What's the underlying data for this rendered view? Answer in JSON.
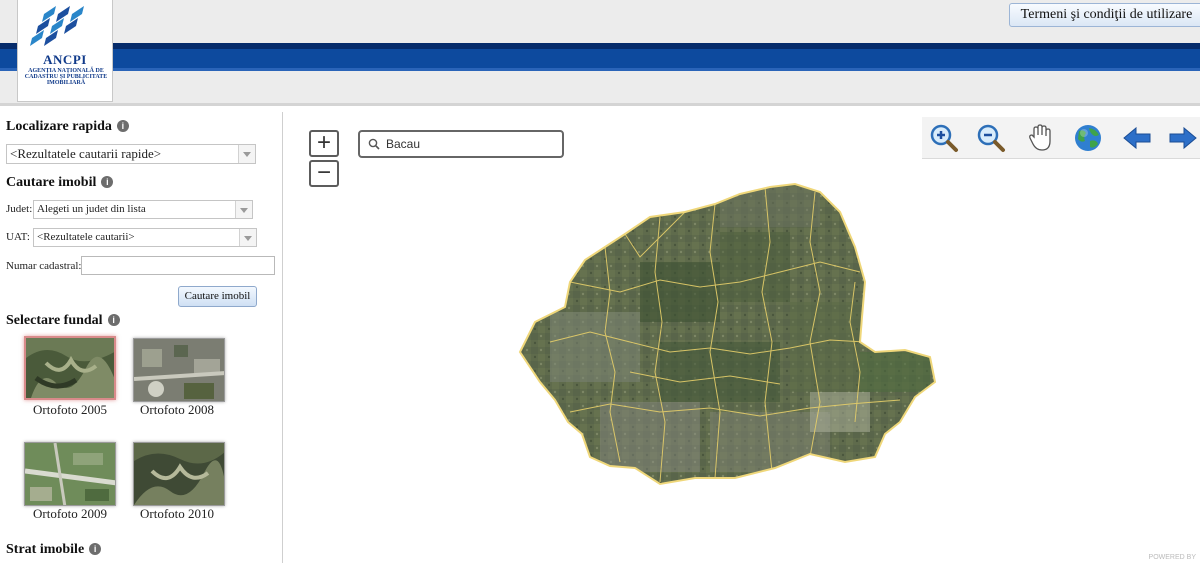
{
  "header": {
    "logo_text": "ANCPI",
    "logo_subtitle": "AGENȚIA NAȚIONALĂ DE CADASTRU ȘI PUBLICITATE IMOBILIARĂ",
    "terms_button": "Termeni şi condiţii de utilizare",
    "colors": {
      "brand_blue": "#0d4a9e"
    }
  },
  "sidebar": {
    "quick_locate": {
      "title": "Localizare rapida",
      "select_value": "<Rezultatele cautarii rapide>"
    },
    "property_search": {
      "title": "Cautare imobil",
      "county_label": "Judet:",
      "county_value": "Alegeti un judet din lista",
      "uat_label": "UAT:",
      "uat_value": "<Rezultatele cautarii>",
      "cadastral_label": "Numar cadastral:",
      "cadastral_value": "",
      "search_button": "Cautare imobil"
    },
    "basemap": {
      "title": "Selectare fundal",
      "options": [
        {
          "label": "Ortofoto 2005",
          "selected": true
        },
        {
          "label": "Ortofoto 2008",
          "selected": false
        },
        {
          "label": "Ortofoto 2009",
          "selected": false
        },
        {
          "label": "Ortofoto 2010",
          "selected": false
        }
      ]
    },
    "property_layer": {
      "title": "Strat imobile"
    }
  },
  "map": {
    "zoom_in": "+",
    "zoom_out": "−",
    "search_value": "Bacau",
    "toolbar": [
      {
        "icon": "zoom-in-icon"
      },
      {
        "icon": "zoom-out-icon"
      },
      {
        "icon": "pan-hand-icon"
      },
      {
        "icon": "globe-full-extent-icon"
      },
      {
        "icon": "arrow-back-icon"
      },
      {
        "icon": "arrow-forward-icon"
      }
    ],
    "watermark": "POWERED BY"
  }
}
